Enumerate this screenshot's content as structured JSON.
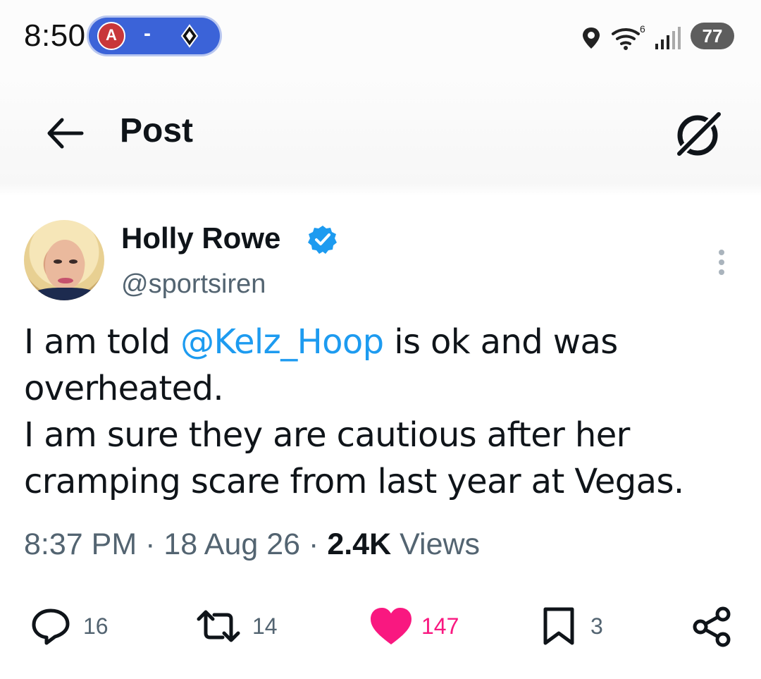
{
  "status_bar": {
    "time": "8:50",
    "live_score": {
      "team1_letter": "A",
      "separator": "-"
    },
    "network_badge": "6",
    "battery": "77"
  },
  "header": {
    "title": "Post"
  },
  "tweet": {
    "author": {
      "display_name": "Holly Rowe",
      "handle": "@sportsiren",
      "verified": true
    },
    "text": {
      "line1_prefix": "I am told ",
      "mention": "@Kelz_Hoop",
      "line1_suffix": " is ok and was overheated.",
      "paragraph2": "I am sure they are cautious after her cramping scare from last year at Vegas."
    },
    "meta": {
      "time": "8:37 PM",
      "date": "18 Aug 26",
      "dot": "·",
      "views_count": "2.4K",
      "views_label": "Views"
    },
    "actions": {
      "replies": "16",
      "reposts": "14",
      "likes": "147",
      "bookmarks": "3"
    }
  },
  "colors": {
    "accent": "#1d9bf0",
    "like": "#f91880",
    "secondary_text": "#536471",
    "primary_text": "#0f1419"
  }
}
